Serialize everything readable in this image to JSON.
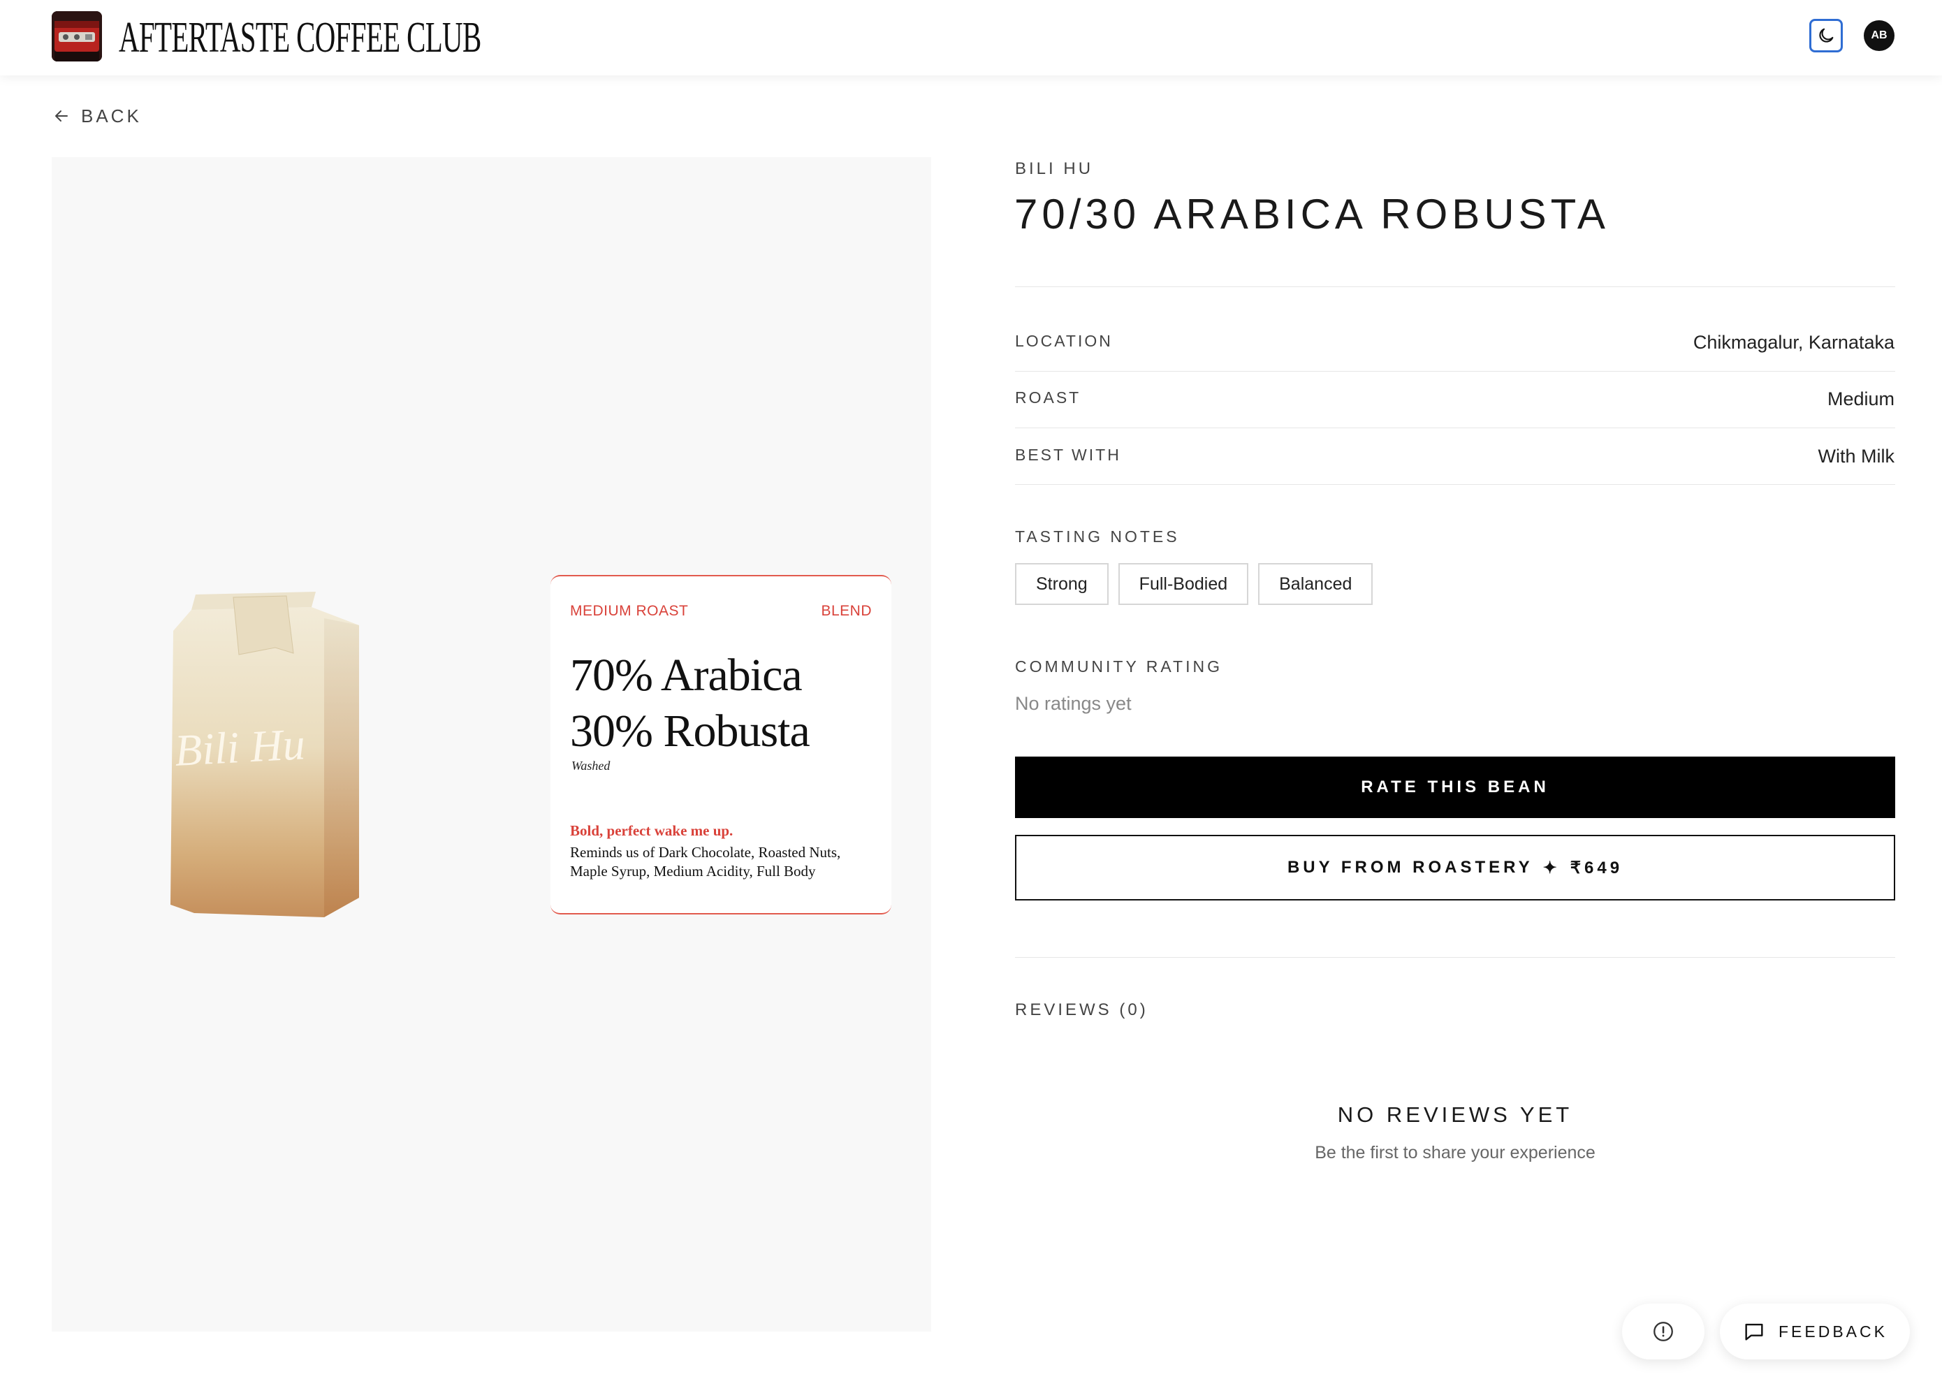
{
  "header": {
    "brand": "AFTERTASTE COFFEE CLUB",
    "avatar_initials": "AB",
    "icons": {
      "logo": "espresso-machine-logo",
      "theme": "moon-icon"
    },
    "accent_color": "#2f6dd3"
  },
  "nav": {
    "back_label": "BACK"
  },
  "product_image": {
    "bag_script": "Bili Hu",
    "card": {
      "roast": "MEDIUM ROAST",
      "type": "BLEND",
      "line1": "70% Arabica",
      "line2": "30% Robusta",
      "process": "Washed",
      "tagline": "Bold, perfect wake me up.",
      "description": "Reminds us of Dark Chocolate, Roasted Nuts, Maple Syrup, Medium Acidity, Full Body",
      "accent_color": "#d9423a"
    }
  },
  "details": {
    "roaster": "BILI HU",
    "title": "70/30 ARABICA ROBUSTA",
    "attributes": [
      {
        "label": "LOCATION",
        "value": "Chikmagalur, Karnataka"
      },
      {
        "label": "ROAST",
        "value": "Medium"
      },
      {
        "label": "BEST WITH",
        "value": "With Milk"
      }
    ],
    "tasting_notes_label": "TASTING NOTES",
    "tasting_notes": [
      "Strong",
      "Full-Bodied",
      "Balanced"
    ],
    "community_rating_label": "COMMUNITY RATING",
    "community_rating_value": "No ratings yet",
    "rate_button": "RATE THIS BEAN",
    "buy_button": {
      "prefix": "BUY FROM ROASTERY",
      "separator": "✦",
      "price": "₹649"
    }
  },
  "reviews": {
    "label": "REVIEWS (0)",
    "empty_title": "NO REVIEWS YET",
    "empty_subtitle": "Be the first to share your experience"
  },
  "floating": {
    "info_icon": "info-circle-icon",
    "feedback_label": "FEEDBACK",
    "feedback_icon": "chat-bubble-icon"
  }
}
